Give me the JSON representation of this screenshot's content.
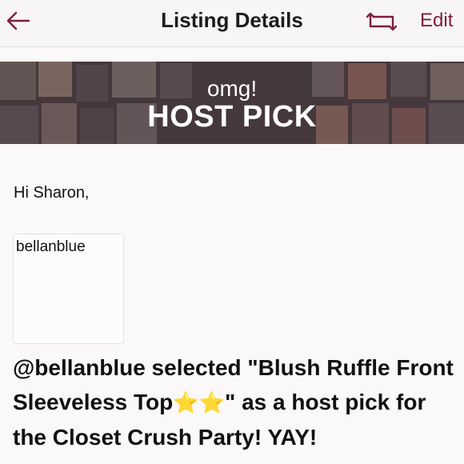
{
  "header": {
    "title": "Listing Details",
    "edit_label": "Edit",
    "back_icon": "arrow-left-icon",
    "share_icon": "repost-icon",
    "accent_color": "#7d1f3b"
  },
  "banner": {
    "top_text": "omg!",
    "main_text": "HOST PICK"
  },
  "content": {
    "greeting": "Hi Sharon,",
    "card_username": "bellanblue",
    "message_part1": "@bellanblue selected \"Blush Ruffle Front Sleeveless Top",
    "stars": "⭐⭐",
    "message_part2": "\" as a host pick for the Closet Crush Party! YAY!"
  }
}
